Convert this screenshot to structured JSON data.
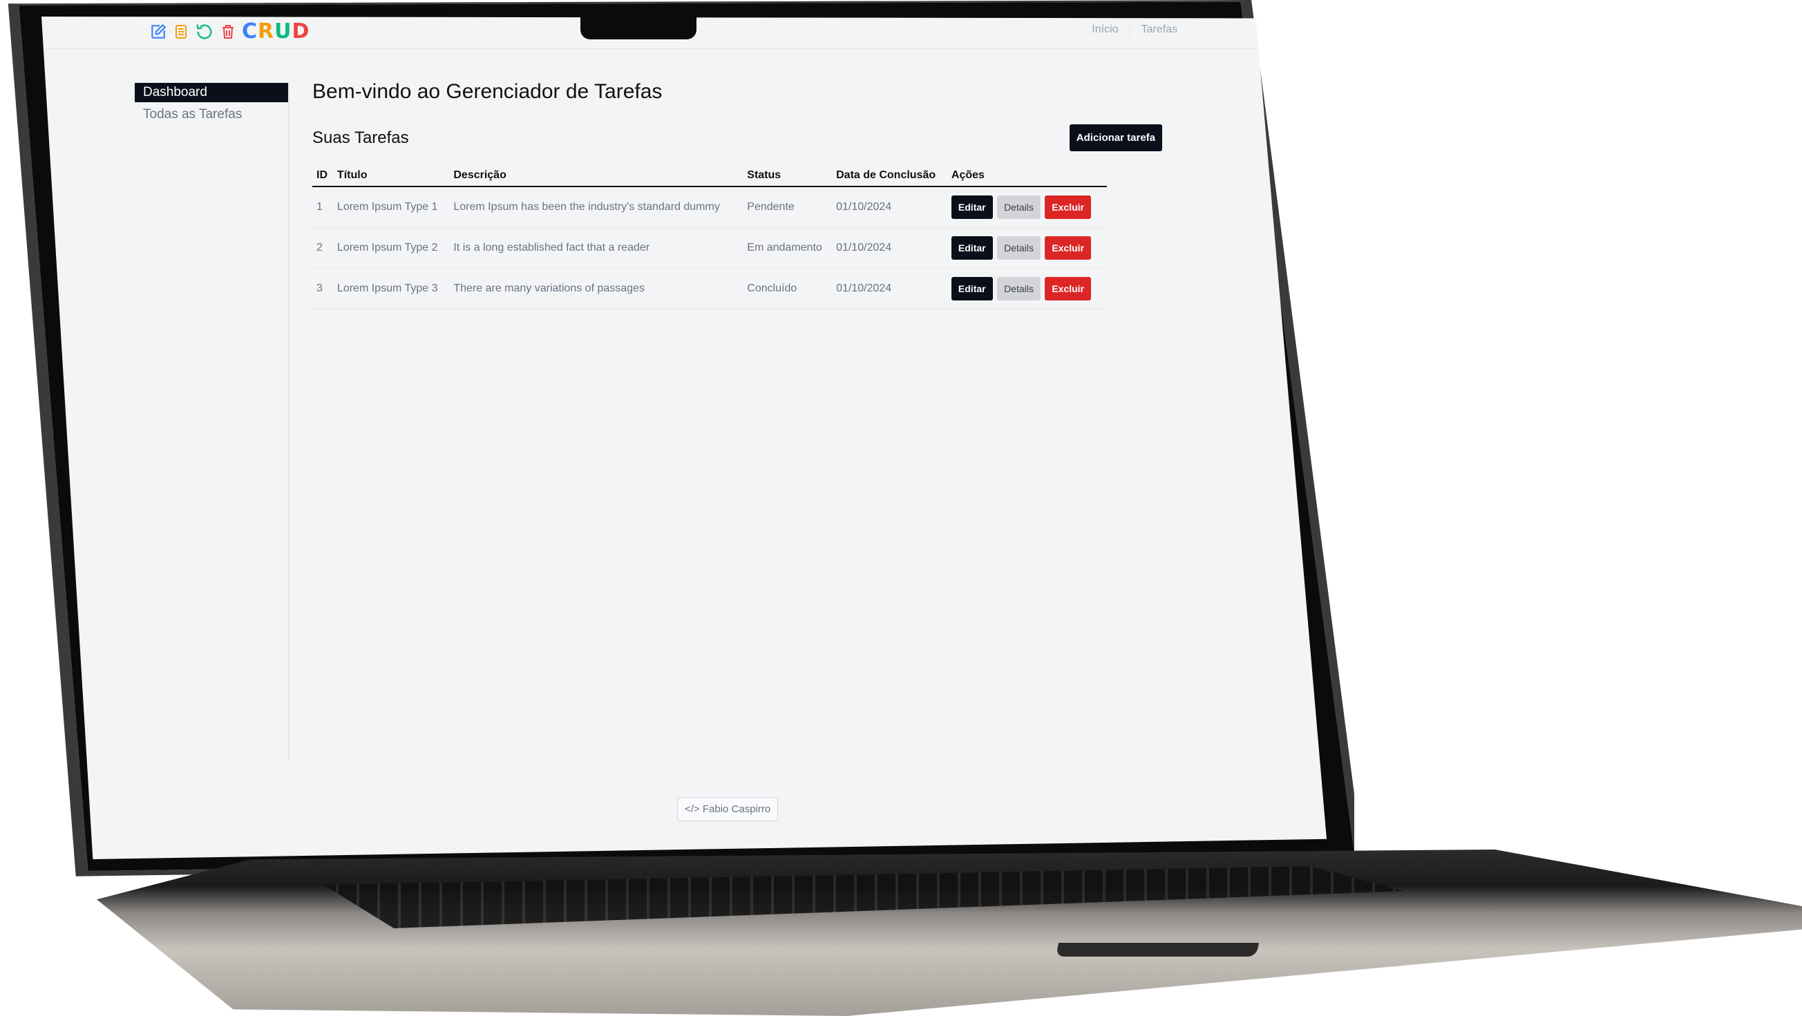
{
  "app": {
    "logo_text": [
      "C",
      "R",
      "U",
      "D"
    ],
    "logo_icons": [
      "edit-icon",
      "document-icon",
      "refresh-icon",
      "trash-icon"
    ]
  },
  "topnav": {
    "items": [
      "Início",
      "Tarefas"
    ]
  },
  "sidebar": {
    "items": [
      {
        "label": "Dashboard",
        "active": true
      },
      {
        "label": "Todas as Tarefas",
        "active": false
      }
    ]
  },
  "main": {
    "title": "Bem-vindo ao Gerenciador de Tarefas",
    "section_title": "Suas Tarefas",
    "add_button": "Adicionar tarefa",
    "table": {
      "headers": [
        "ID",
        "Título",
        "Descrição",
        "Status",
        "Data de Conclusão",
        "Ações"
      ],
      "rows": [
        {
          "id": "1",
          "title": "Lorem Ipsum Type 1",
          "description": "Lorem Ipsum has been the industry's standard dummy",
          "status": "Pendente",
          "date": "01/10/2024"
        },
        {
          "id": "2",
          "title": "Lorem Ipsum Type 2",
          "description": "It is a long established fact that a reader",
          "status": "Em andamento",
          "date": "01/10/2024"
        },
        {
          "id": "3",
          "title": "Lorem Ipsum Type 3",
          "description": "There are many variations of passages",
          "status": "Concluído",
          "date": "01/10/2024"
        }
      ],
      "actions": {
        "edit": "Editar",
        "details": "Details",
        "delete": "Excluir"
      }
    }
  },
  "footer": {
    "credit": "Fabio Caspirro",
    "icon": "code-icon"
  },
  "colors": {
    "accent_dark": "#0b0f1a",
    "danger": "#dc2626",
    "neutral_button": "#d4d4d8",
    "logo": [
      "#3b82f6",
      "#f59e0b",
      "#10b981",
      "#ef4444"
    ]
  }
}
